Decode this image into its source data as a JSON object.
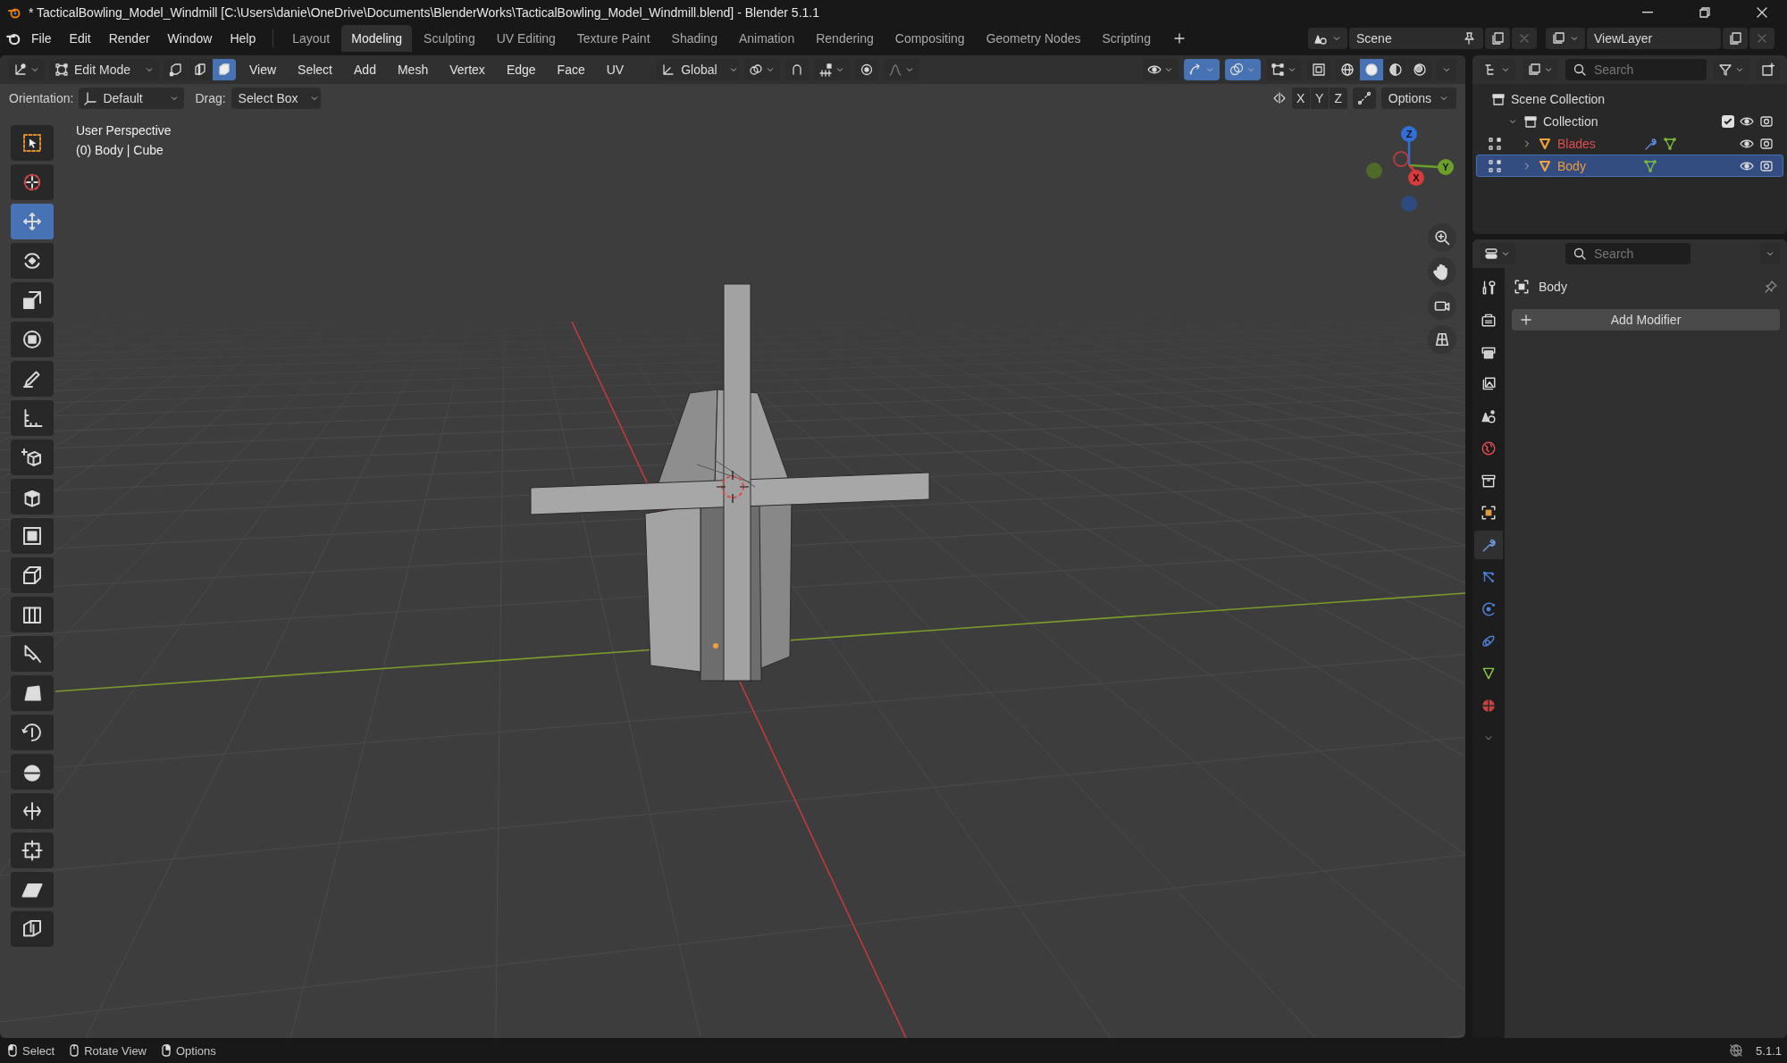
{
  "window": {
    "title": "* TacticalBowling_Model_Windmill [C:\\Users\\danie\\OneDrive\\Documents\\BlenderWorks\\TacticalBowling_Model_Windmill.blend] - Blender 5.1.1"
  },
  "menu": [
    "File",
    "Edit",
    "Render",
    "Window",
    "Help"
  ],
  "workspaces": [
    {
      "label": "Layout",
      "selected": false
    },
    {
      "label": "Modeling",
      "selected": true
    },
    {
      "label": "Sculpting",
      "selected": false
    },
    {
      "label": "UV Editing",
      "selected": false
    },
    {
      "label": "Texture Paint",
      "selected": false
    },
    {
      "label": "Shading",
      "selected": false
    },
    {
      "label": "Animation",
      "selected": false
    },
    {
      "label": "Rendering",
      "selected": false
    },
    {
      "label": "Compositing",
      "selected": false
    },
    {
      "label": "Geometry Nodes",
      "selected": false
    },
    {
      "label": "Scripting",
      "selected": false
    }
  ],
  "scene": {
    "value": "Scene"
  },
  "view_layer": {
    "value": "ViewLayer"
  },
  "viewport": {
    "mode": "Edit Mode",
    "select_modes": [
      {
        "kind": "vertex",
        "selected": false
      },
      {
        "kind": "edge",
        "selected": false
      },
      {
        "kind": "face",
        "selected": true
      }
    ],
    "menus": [
      "View",
      "Select",
      "Add",
      "Mesh",
      "Vertex",
      "Edge",
      "Face",
      "UV"
    ],
    "orientation": "Global",
    "view_toggles": [
      {
        "kind": "visibility",
        "on": false
      },
      {
        "kind": "gizmo",
        "on": true
      },
      {
        "kind": "overlay",
        "on": true
      },
      {
        "kind": "mesh-overlay",
        "on": false
      },
      {
        "kind": "xray",
        "on": false
      }
    ],
    "shading": [
      {
        "kind": "wireframe",
        "selected": false
      },
      {
        "kind": "solid",
        "selected": true
      },
      {
        "kind": "material",
        "selected": false
      },
      {
        "kind": "rendered",
        "selected": false
      }
    ],
    "overlay_text": [
      "User Perspective",
      "(0) Body | Cube"
    ],
    "gizmo_axes": [
      "Z",
      "Y",
      "X"
    ]
  },
  "tool_settings": {
    "orientation_label": "Orientation:",
    "orientation": "Default",
    "drag_label": "Drag:",
    "drag": "Select Box",
    "mirror_axes": [
      {
        "label": "X",
        "on": false
      },
      {
        "label": "Y",
        "on": false
      },
      {
        "label": "Z",
        "on": false
      }
    ],
    "options": "Options"
  },
  "tools": [
    {
      "kind": "select-box",
      "selected": false
    },
    {
      "kind": "cursor",
      "selected": false
    },
    {
      "kind": "move",
      "selected": true
    },
    {
      "kind": "rotate",
      "selected": false
    },
    {
      "kind": "scale",
      "selected": false
    },
    {
      "kind": "transform",
      "selected": false
    },
    {
      "kind": "pencil",
      "selected": false
    },
    {
      "kind": "ruler",
      "selected": false
    },
    {
      "kind": "add-cube",
      "selected": false
    },
    {
      "kind": "extrude",
      "selected": false
    },
    {
      "kind": "inset",
      "selected": false
    },
    {
      "kind": "bevel",
      "selected": false
    },
    {
      "kind": "loop-cut",
      "selected": false
    },
    {
      "kind": "knife",
      "selected": false
    },
    {
      "kind": "polygon",
      "selected": false
    },
    {
      "kind": "spin",
      "selected": false
    },
    {
      "kind": "sphere",
      "selected": false
    },
    {
      "kind": "edge-slide",
      "selected": false
    },
    {
      "kind": "shrink",
      "selected": false
    },
    {
      "kind": "shear",
      "selected": false
    },
    {
      "kind": "rip",
      "selected": false
    }
  ],
  "outliner": {
    "search_placeholder": "Search",
    "tree": [
      {
        "name": "Scene Collection",
        "kind": "scene",
        "children": [
          {
            "name": "Collection",
            "kind": "collection",
            "expanded": true,
            "checked": true,
            "children": [
              {
                "name": "Blades",
                "kind": "object",
                "color": "#e04c4c",
                "expanded": false,
                "selected": false,
                "has_modifier": true
              },
              {
                "name": "Body",
                "kind": "object",
                "color": "#f29b3a",
                "expanded": false,
                "selected": true,
                "has_modifier": false
              }
            ]
          }
        ]
      }
    ]
  },
  "properties": {
    "search_placeholder": "Search",
    "tabs": [
      {
        "kind": "tool",
        "selected": false
      },
      {
        "kind": "render",
        "selected": false
      },
      {
        "kind": "output",
        "selected": false
      },
      {
        "kind": "view-layer",
        "selected": false
      },
      {
        "kind": "scene",
        "selected": false
      },
      {
        "kind": "world",
        "selected": false
      },
      {
        "kind": "collection",
        "selected": false
      },
      {
        "kind": "object",
        "selected": false
      },
      {
        "kind": "modifier",
        "selected": true
      },
      {
        "kind": "particles",
        "selected": false
      },
      {
        "kind": "physics",
        "selected": false
      },
      {
        "kind": "constraints",
        "selected": false
      },
      {
        "kind": "mesh-data",
        "selected": false
      },
      {
        "kind": "material",
        "selected": false
      }
    ],
    "object_name": "Body",
    "add_modifier": "Add Modifier"
  },
  "status_bar": {
    "hints": [
      "Select",
      "Rotate View",
      "Options"
    ],
    "version": "5.1.1"
  }
}
